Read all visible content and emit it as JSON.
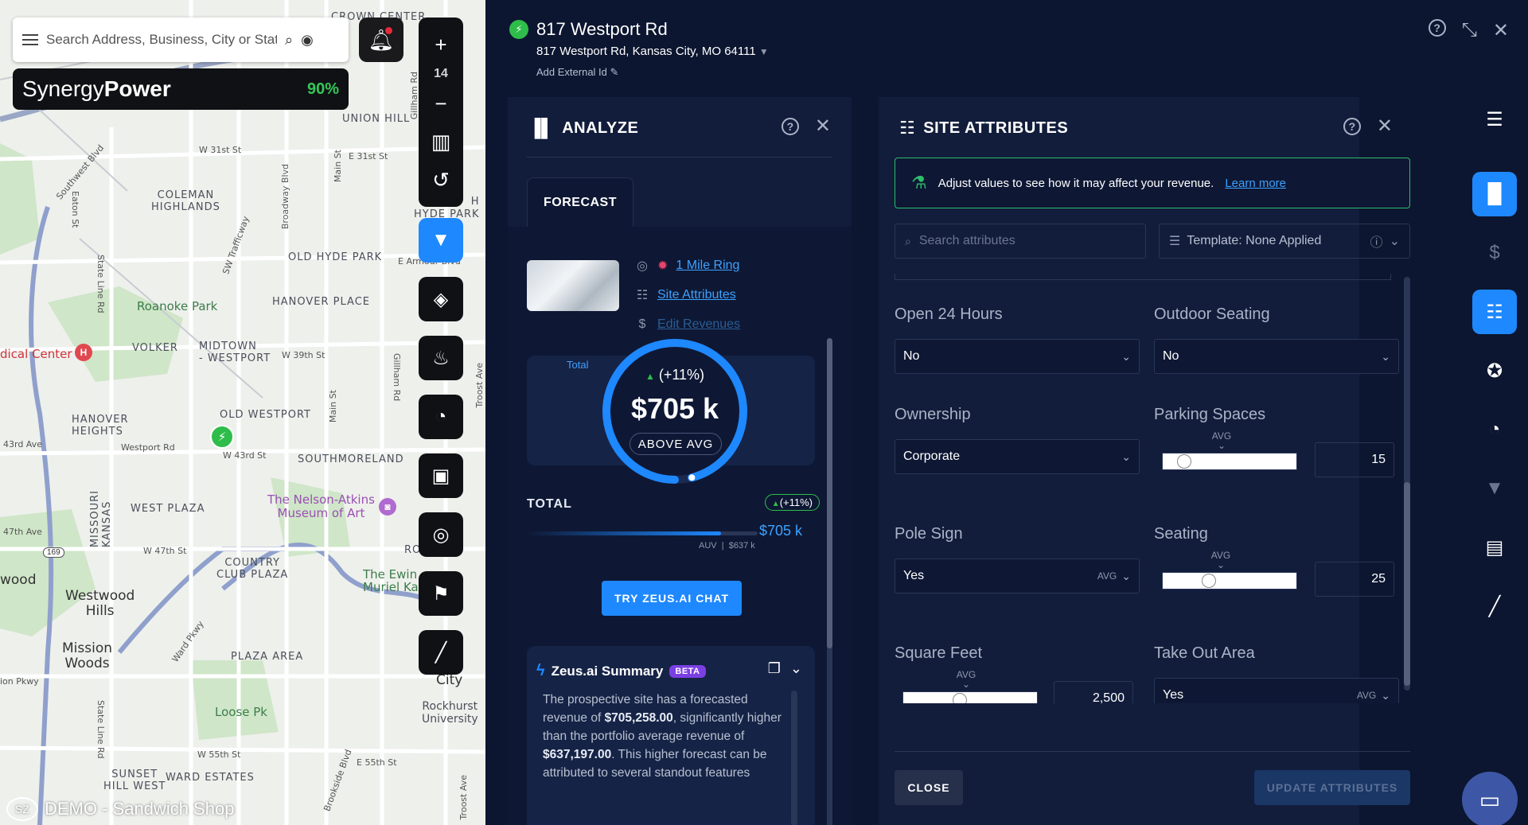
{
  "map": {
    "search_placeholder": "Search Address, Business, City or State",
    "brand_prefix": "Synergy",
    "brand_bold": "Power",
    "brand_percent": "90%",
    "zoom_level": "14",
    "watermark": "DEMO - Sandwich Shop",
    "watermark_logo": "SZ",
    "labels": {
      "crown_center": "CROWN CENTER",
      "union_hill": "UNION HILL",
      "w31st": "W 31st St",
      "e31st": "E 31st St",
      "coleman": "COLEMAN\nHIGHLANDS",
      "hyde_park": "H\nHYDE PARK",
      "old_hyde_park": "OLD HYDE PARK",
      "armour": "E Armour Blvd",
      "roanoke": "Roanoke Park",
      "hanover": "HANOVER PLACE",
      "medical": "dical Center",
      "volker": "VOLKER",
      "midtown": "MIDTOWN\n- WESTPORT",
      "w39th": "W 39th St",
      "old_westport": "OLD WESTPORT",
      "hanover_heights": "HANOVER\nHEIGHTS",
      "e43rd": "43rd Ave",
      "westport_rd": "Westport Rd",
      "w43rd": "W 43rd St",
      "southmoreland": "SOUTHMORELAND",
      "nelson": "The Nelson-Atkins\nMuseum of Art",
      "west_plaza": "WEST PLAZA",
      "missouri_kansas": "MISSOURI\nKANSAS",
      "w47th": "W 47th St",
      "47th_ave": "47th Ave",
      "country_club": "COUNTRY\nCLUB PLAZA",
      "ewing": "The Ewin\nMuriel Kau",
      "wood": "wood",
      "westwood_hills": "Westwood\nHills",
      "mission_woods": "Mission\nWoods",
      "plaza_area": "PLAZA AREA",
      "loose_pk": "Loose Pk",
      "rockhurst": "Rockhurst\nUniversity",
      "w55th": "W 55th St",
      "e55th": "E 55th St",
      "sunset_hill": "SUNSET\nHILL WEST",
      "ward_estates": "WARD ESTATES",
      "ro": "RO",
      "city": "City",
      "state_line": "State Line Rd",
      "main_st": "Main St",
      "broadway": "Broadway Blvd",
      "trafficway": "SW Trafficway",
      "southwest_blvd": "Southwest Blvd",
      "eaton": "Eaton St",
      "gillham": "Gillham Rd",
      "ward_pkwy": "Ward Pkwy",
      "pkwy": "ion Pkwy",
      "rt169": "169",
      "troost": "Troost Ave",
      "brookside": "Brookside Blvd"
    }
  },
  "site": {
    "name": "817 Westport Rd",
    "address": "817 Westport Rd, Kansas City, MO 64111",
    "external_id": "Add External Id"
  },
  "analyze": {
    "title": "ANALYZE",
    "tab": "FORECAST",
    "links": [
      "1 Mile Ring",
      "Site Attributes",
      "Edit Revenues"
    ],
    "total_label": "Total",
    "change": "(+11%)",
    "amount": "$705 k",
    "avg_status": "ABOVE AVG",
    "gauge_fraction": 0.96,
    "total_row_label": "TOTAL",
    "total_badge": "(+11%)",
    "total_value": "$705 k",
    "auv_label": "AUV",
    "auv_value": "$637 k",
    "bar_fraction": 0.84,
    "zeus_button": "TRY ZEUS.AI CHAT",
    "summary_title": "Zeus.ai Summary",
    "summary_beta": "BETA",
    "summary_p1": "The prospective site has a forecasted revenue of ",
    "summary_b1": "$705,258.00",
    "summary_p2": ", significantly higher than the portfolio average revenue of ",
    "summary_b2": "$637,197.00",
    "summary_p3": ". This higher forecast can be attributed to several standout features"
  },
  "attributes": {
    "title": "SITE ATTRIBUTES",
    "banner_text": "Adjust values to see how it may affect your revenue.",
    "banner_link": "Learn more",
    "search_placeholder": "Search attributes",
    "template": "Template: None Applied",
    "avg_label": "AVG",
    "fields": {
      "open24": {
        "label": "Open 24 Hours",
        "value": "No"
      },
      "outdoor": {
        "label": "Outdoor Seating",
        "value": "No"
      },
      "ownership": {
        "label": "Ownership",
        "value": "Corporate"
      },
      "parking": {
        "label": "Parking Spaces",
        "value": "15",
        "slider_fraction": 0.12
      },
      "pole": {
        "label": "Pole Sign",
        "value": "Yes"
      },
      "seating": {
        "label": "Seating",
        "value": "25",
        "slider_fraction": 0.33
      },
      "sqft": {
        "label": "Square Feet",
        "value": "2,500",
        "slider_fraction": 0.42
      },
      "takeout": {
        "label": "Take Out Area",
        "value": "Yes"
      }
    },
    "close_button": "CLOSE",
    "update_button": "UPDATE ATTRIBUTES"
  },
  "colors": {
    "accent": "#1e88ff",
    "positive": "#2ebd4a",
    "panel_bg": "#121d3c",
    "page_bg": "#0c1630"
  }
}
